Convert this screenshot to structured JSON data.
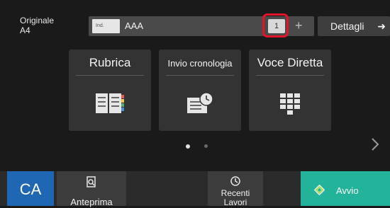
{
  "header": {
    "original_label": "Originale",
    "original_size": "A4",
    "address_tag": "Ind.",
    "address_value": "AAA",
    "copies": "1",
    "plus_symbol": "+",
    "details_label": "Dettagli",
    "details_arrow": "➜"
  },
  "tiles": [
    {
      "label": "Rubrica",
      "icon": "address-book-icon"
    },
    {
      "label": "Invio cronologia",
      "icon": "send-history-icon"
    },
    {
      "label": "Voce Diretta",
      "icon": "keypad-icon"
    }
  ],
  "pager": {
    "page": 1,
    "pages": 2
  },
  "bottom": {
    "ca_label": "CA",
    "preview_label": "Anteprima",
    "recent_label": "Recenti",
    "recent_label2": "Lavori",
    "start_label": "Avvio"
  },
  "colors": {
    "background": "#1a1a1a",
    "tile": "#333333",
    "ca": "#1f66b3",
    "start": "#23b39a",
    "highlight": "#e0152b"
  }
}
